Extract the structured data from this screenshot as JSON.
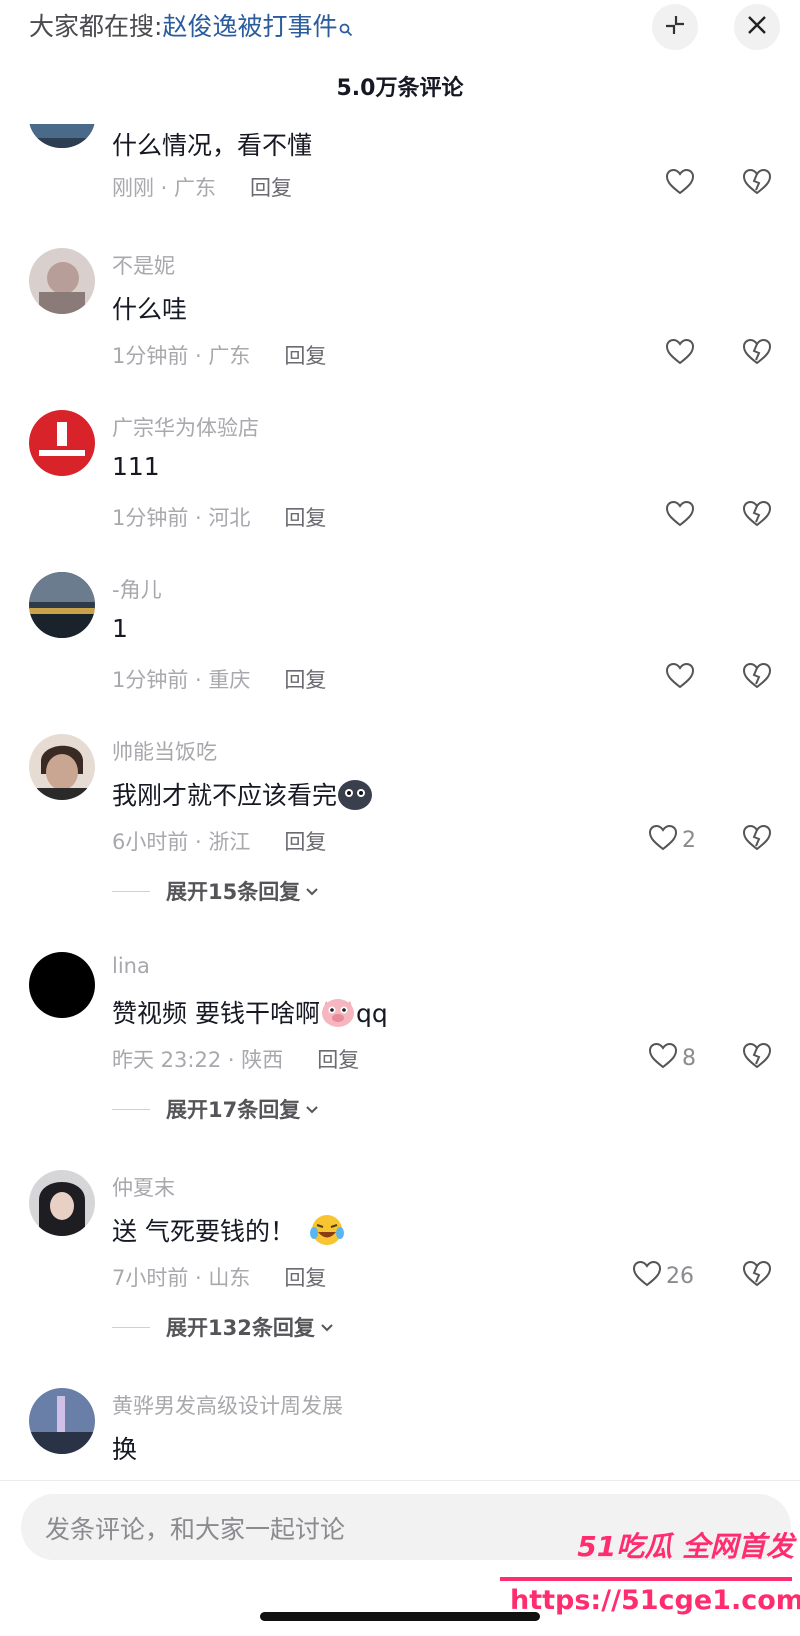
{
  "header": {
    "search_prefix": "大家都在搜:",
    "search_term": "赵俊逸被打事件",
    "comment_count": "5.0万条评论"
  },
  "comments": [
    {
      "name": "",
      "text": "什么情况，看不懂",
      "time_location": "刚刚 · 广东",
      "reply_label": "回复",
      "likes": "",
      "avatar_color": "#3f5c78"
    },
    {
      "name": "不是妮",
      "text": "什么哇",
      "time_location": "1分钟前 · 广东",
      "reply_label": "回复",
      "likes": "",
      "avatar_color": "#c9b8b6"
    },
    {
      "name": "广宗华为体验店",
      "text": "111",
      "time_location": "1分钟前 · 河北",
      "reply_label": "回复",
      "likes": "",
      "avatar_color": "#d8232a"
    },
    {
      "name": "-角儿",
      "text": "1",
      "time_location": "1分钟前 · 重庆",
      "reply_label": "回复",
      "likes": "",
      "avatar_color": "#3d4b5a"
    },
    {
      "name": "帅能当饭吃",
      "text": "我刚才就不应该看完",
      "time_location": "6小时前 · 浙江",
      "reply_label": "回复",
      "likes": "2",
      "expand": "展开15条回复",
      "avatar_color": "#5a4a42"
    },
    {
      "name": "lina",
      "text": "赞视频 要钱干啥啊",
      "text_suffix": "qq",
      "time_location": "昨天 23:22 · 陕西",
      "reply_label": "回复",
      "likes": "8",
      "expand": "展开17条回复",
      "avatar_color": "#000000"
    },
    {
      "name": "仲夏末",
      "text": "送 气死要钱的！",
      "time_location": "7小时前 · 山东",
      "reply_label": "回复",
      "likes": "26",
      "expand": "展开132条回复",
      "avatar_color": "#2a2a2e"
    },
    {
      "name": "黄骅男发高级设计周发展",
      "text": "换",
      "avatar_color": "#4a5878"
    }
  ],
  "input": {
    "placeholder": "发条评论，和大家一起讨论"
  },
  "watermark": {
    "brand": "51吃瓜 全网首发",
    "url": "https://51cge1.com"
  },
  "colors": {
    "accent_link": "#2b5c9d",
    "watermark": "#ff2d6f",
    "muted_text": "#a8a8ad"
  }
}
